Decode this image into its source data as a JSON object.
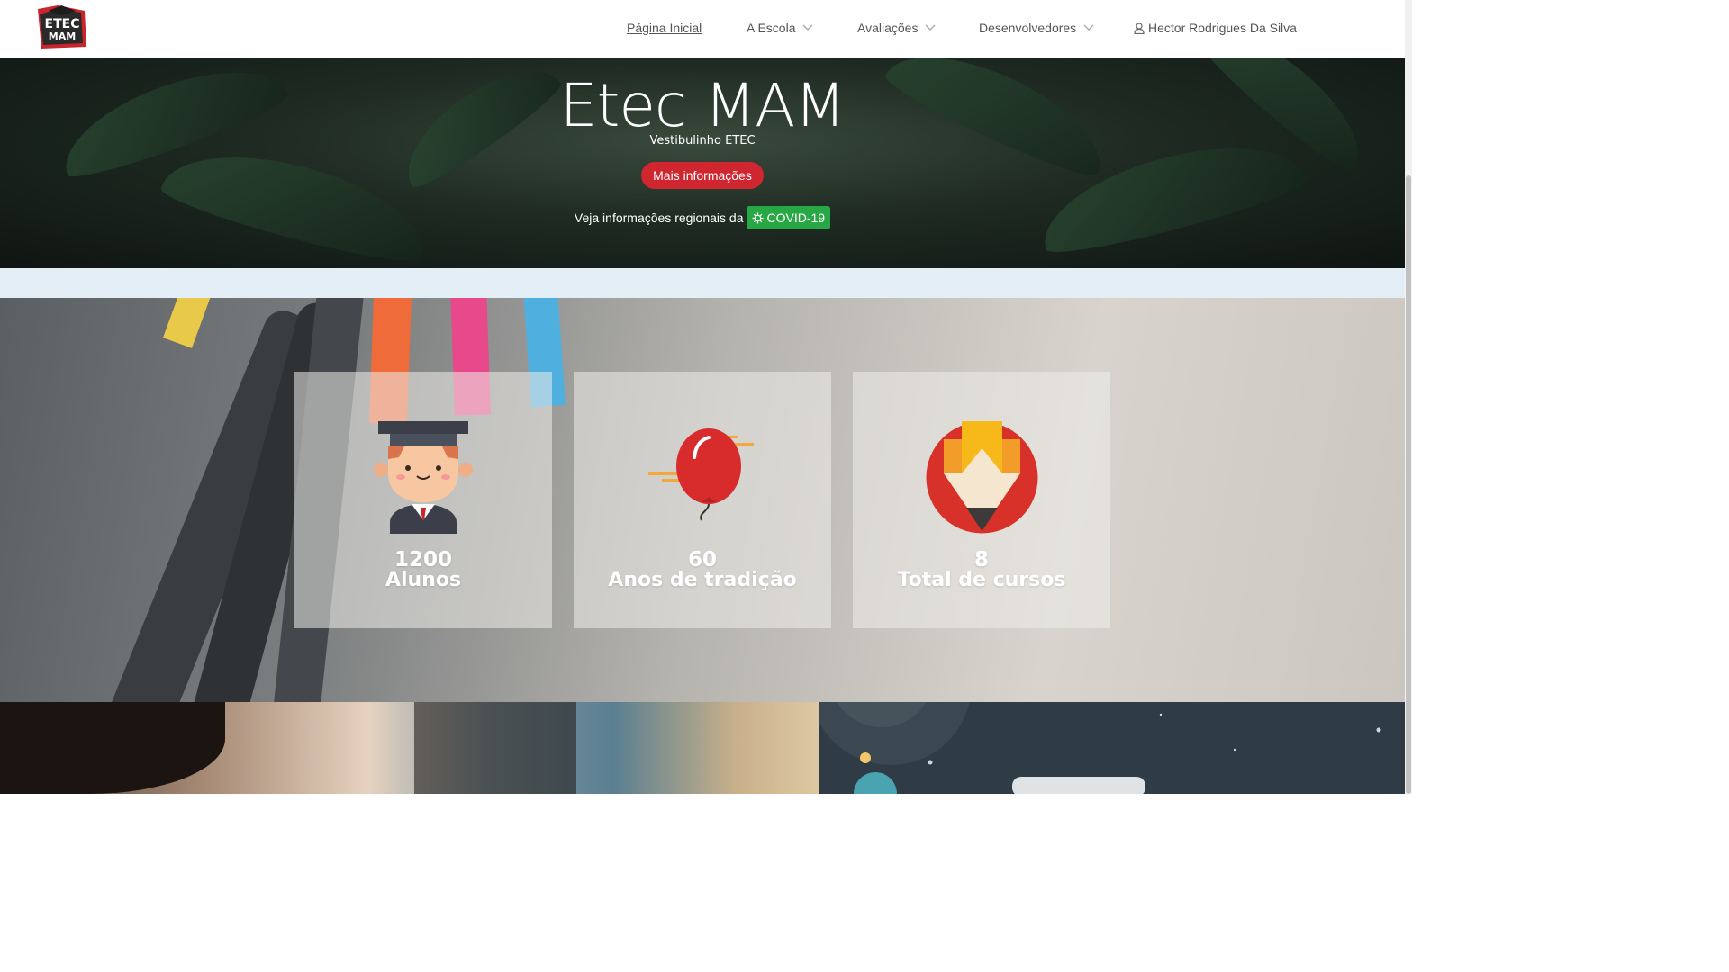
{
  "nav": {
    "logo_text_top": "ETEC",
    "logo_text_bottom": "MAM",
    "items": [
      {
        "label": "Página Inicial"
      },
      {
        "label": "A Escola"
      },
      {
        "label": "Avaliações"
      },
      {
        "label": "Desenvolvedores"
      },
      {
        "label": "Hector Rodrigues Da Silva"
      }
    ]
  },
  "hero": {
    "title": "Etec MAM",
    "subtitle": "Vestibulinho ETEC",
    "button_label": "Mais informações",
    "covid_prefix": "Veja informações regionais da",
    "covid_badge": "COVID-19"
  },
  "stats": [
    {
      "number": "1200",
      "label": "Alunos",
      "icon": "graduate-icon"
    },
    {
      "number": "60",
      "label": "Anos de tradição",
      "icon": "balloon-icon"
    },
    {
      "number": "8",
      "label": "Total de cursos",
      "icon": "pencil-badge-icon"
    }
  ],
  "colors": {
    "accent_red": "#d0262f",
    "covid_green": "#28a745"
  }
}
